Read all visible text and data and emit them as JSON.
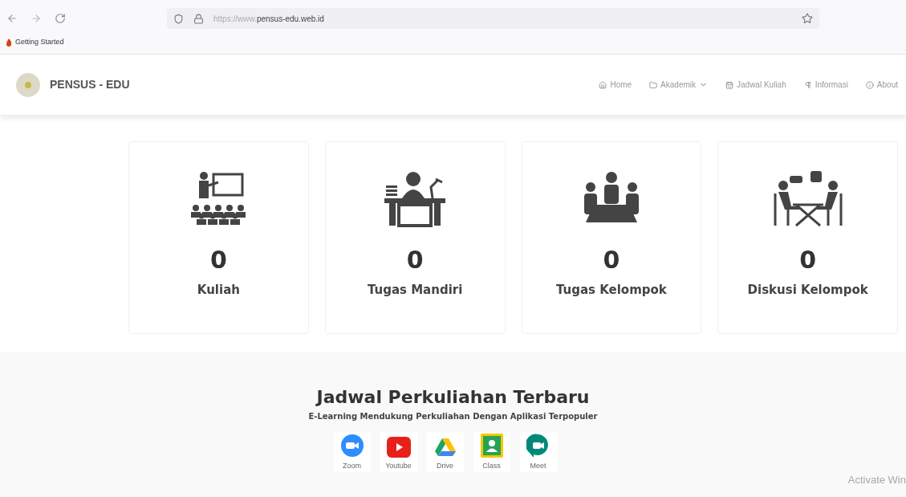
{
  "browser": {
    "url_prefix": "https://www.",
    "url_host": "pensus-edu.web.id",
    "bookmarks": [
      "Getting Started"
    ]
  },
  "navbar": {
    "brand": "PENSUS - EDU",
    "items": [
      {
        "label": "Home",
        "dropdown": false
      },
      {
        "label": "Akademik",
        "dropdown": true
      },
      {
        "label": "Jadwal Kuliah",
        "dropdown": false
      },
      {
        "label": "Informasi",
        "dropdown": false
      },
      {
        "label": "About",
        "dropdown": false
      }
    ]
  },
  "stats": [
    {
      "count": "0",
      "label": "Kuliah"
    },
    {
      "count": "0",
      "label": "Tugas Mandiri"
    },
    {
      "count": "0",
      "label": "Tugas Kelompok"
    },
    {
      "count": "0",
      "label": "Diskusi Kelompok"
    }
  ],
  "schedule": {
    "title": "Jadwal Perkuliahan Terbaru",
    "subtitle": "E-Learning Mendukung Perkuliahan Dengan Aplikasi Terpopuler",
    "apps": [
      "Zoom",
      "Youtube",
      "Drive",
      "Class",
      "Meet"
    ]
  },
  "os_notice": "Activate Win"
}
